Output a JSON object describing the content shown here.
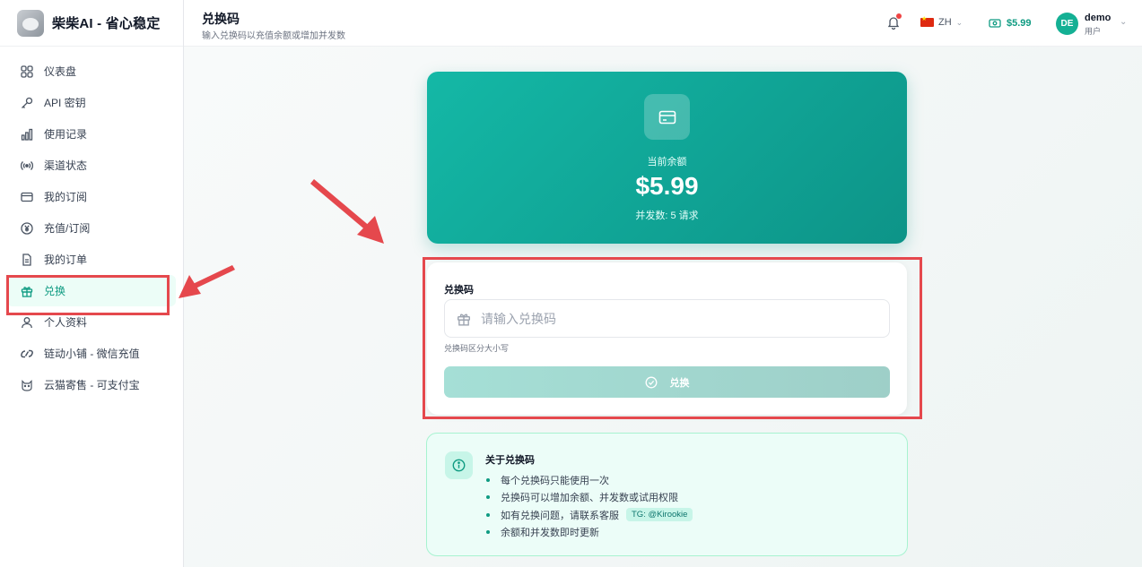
{
  "brand": {
    "title": "柴柴AI - 省心稳定"
  },
  "sidebar": {
    "items": [
      {
        "label": "仪表盘",
        "icon": "dashboard-icon"
      },
      {
        "label": "API 密钥",
        "icon": "key-icon"
      },
      {
        "label": "使用记录",
        "icon": "bar-chart-icon"
      },
      {
        "label": "渠道状态",
        "icon": "broadcast-icon"
      },
      {
        "label": "我的订阅",
        "icon": "credit-card-icon"
      },
      {
        "label": "充值/订阅",
        "icon": "yuan-icon"
      },
      {
        "label": "我的订单",
        "icon": "document-icon"
      },
      {
        "label": "兑换",
        "icon": "gift-icon",
        "active": true
      },
      {
        "label": "个人资料",
        "icon": "user-icon"
      },
      {
        "label": "链动小铺 - 微信充值",
        "icon": "link-icon"
      },
      {
        "label": "云猫寄售 - 可支付宝",
        "icon": "cat-icon"
      }
    ]
  },
  "header": {
    "title": "兑换码",
    "subtitle": "输入兑换码以充值余额或增加并发数",
    "language": "ZH",
    "balance": "$5.99",
    "user": {
      "initials": "DE",
      "name": "demo",
      "role": "用户"
    }
  },
  "balance_card": {
    "label": "当前余额",
    "amount": "$5.99",
    "concurrency": "并发数: 5 请求"
  },
  "redeem_form": {
    "label": "兑换码",
    "placeholder": "请输入兑换码",
    "hint": "兑换码区分大小写",
    "button_label": "兑换"
  },
  "info": {
    "title": "关于兑换码",
    "items": [
      "每个兑换码只能使用一次",
      "兑换码可以增加余额、并发数或试用权限",
      "如有兑换问题，请联系客服",
      "余额和并发数即时更新"
    ],
    "contact_badge": "TG: @Kirookie"
  },
  "colors": {
    "accent": "#0f9b82",
    "annotation": "#e5484d"
  }
}
